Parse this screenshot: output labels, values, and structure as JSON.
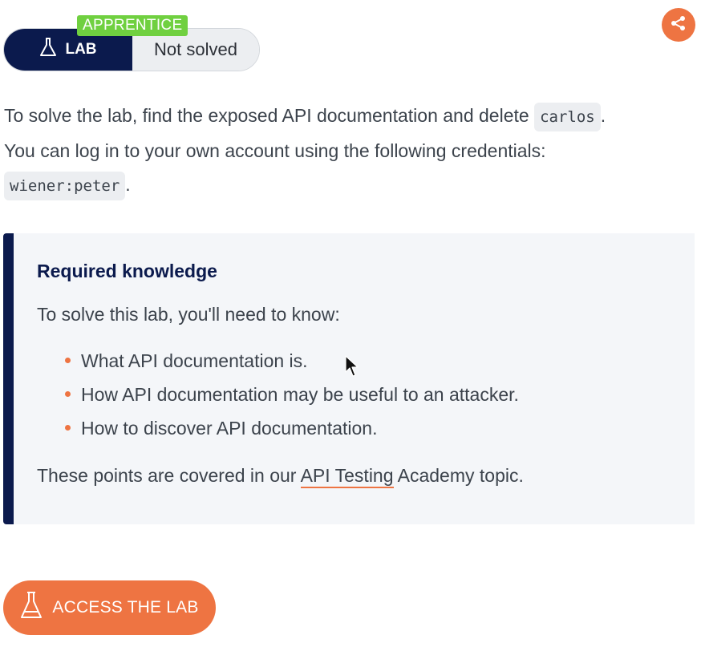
{
  "lab_status": {
    "level": "APPRENTICE",
    "tag": "LAB",
    "state": "Not solved"
  },
  "share": {
    "icon": "share-icon"
  },
  "intro": {
    "line1_pre": "To solve the lab, find the exposed API documentation and delete",
    "target_user": "carlos",
    "line1_post": ".",
    "line2": "You can log in to your own account using the following credentials:",
    "credentials": "wiener:peter",
    "line3_post": "."
  },
  "knowledge": {
    "title": "Required knowledge",
    "lead": "To solve this lab, you'll need to know:",
    "items": [
      "What API documentation is.",
      "How API documentation may be useful to an attacker.",
      "How to discover API documentation."
    ],
    "outro_pre": "These points are covered in our ",
    "outro_link": "API Testing",
    "outro_post": " Academy topic."
  },
  "access_button": {
    "label": "ACCESS THE LAB",
    "icon": "flask-icon"
  },
  "colors": {
    "navy": "#0b1a4d",
    "orange": "#ee7442",
    "green": "#70d040"
  }
}
